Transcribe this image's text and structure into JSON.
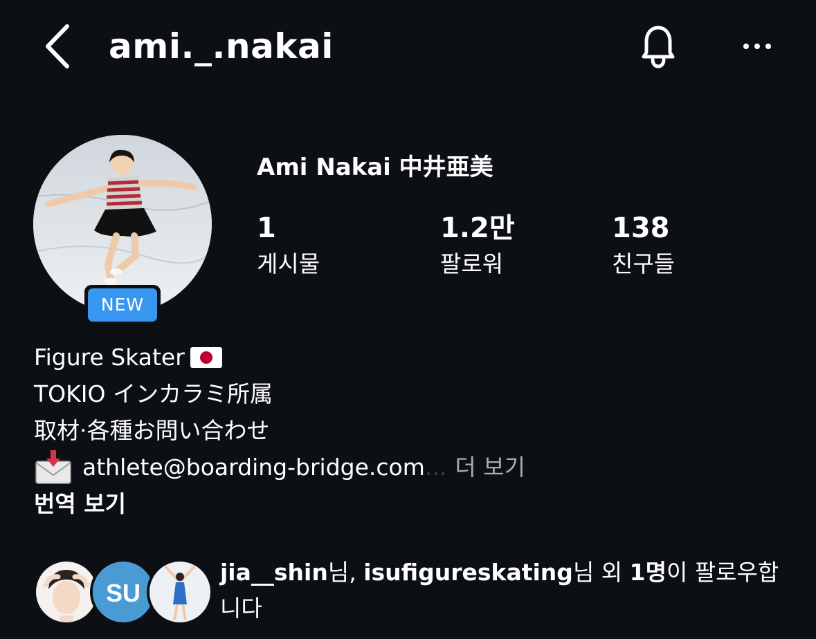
{
  "header": {
    "username": "ami._.nakai",
    "back_icon": "chevron-left-icon",
    "bell_icon": "bell-icon",
    "more_icon": "more-horizontal-icon"
  },
  "profile": {
    "display_name": "Ami Nakai  中井亜美",
    "new_badge": "NEW",
    "stats": [
      {
        "value": "1",
        "label": "게시물"
      },
      {
        "value": "1.2만",
        "label": "팔로워"
      },
      {
        "value": "138",
        "label": "친구들"
      }
    ]
  },
  "bio": {
    "line1": "Figure Skater",
    "line1_emoji": "japan-flag-icon",
    "line2": "TOKIO インカラミ所属",
    "line3": "取材·各種お問い合わせ",
    "line4_emoji": "envelope-with-arrow-icon",
    "line4": "athlete@boarding-bridge.com",
    "ellipsis": "...",
    "more_label": "더 보기",
    "translate_label": "번역 보기"
  },
  "followed_by": {
    "user1": "jia__shin",
    "suffix1": "님, ",
    "user2": "isufigureskating",
    "suffix2": "님 외 ",
    "count": "1명",
    "suffix3": "이 팔로우합니다"
  },
  "colors": {
    "background": "#0c0f14",
    "badge": "#3797f0",
    "muted": "#a8acb3"
  }
}
